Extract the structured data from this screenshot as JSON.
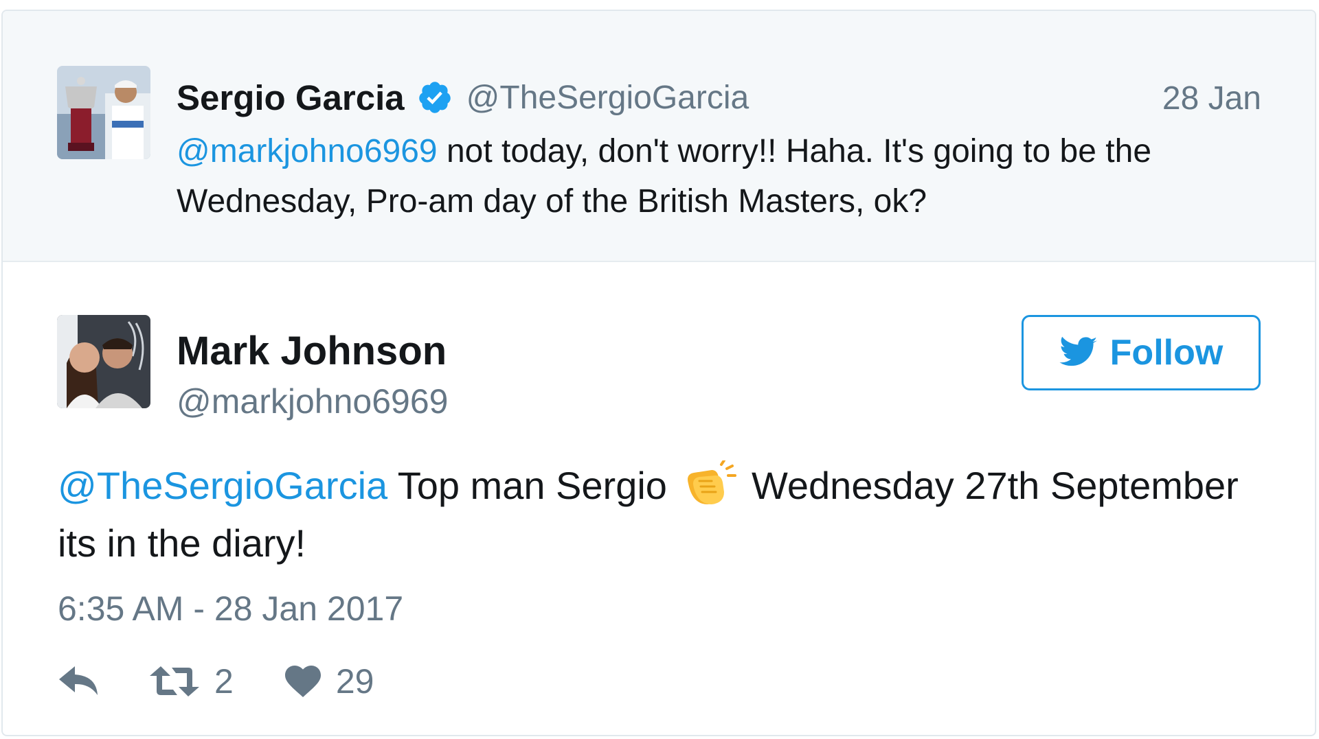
{
  "parent_tweet": {
    "author_name": "Sergio Garcia",
    "author_handle": "@TheSergioGarcia",
    "date": "28 Jan",
    "mention": "@markjohno6969",
    "text": " not today, don't worry!! Haha. It's going to be the Wednesday, Pro-am day of the British Masters, ok?",
    "verified_icon": "verified-badge-icon"
  },
  "reply_tweet": {
    "author_name": "Mark Johnson",
    "author_handle": "@markjohno6969",
    "follow_label": "Follow",
    "mention": "@TheSergioGarcia",
    "text_before_emoji": " Top man Sergio ",
    "emoji": "clapping-hands-emoji",
    "text_after_emoji": " Wednesday 27th September its in the diary!",
    "timestamp": "6:35 AM - 28 Jan 2017",
    "retweet_count": "2",
    "like_count": "29"
  },
  "icons": {
    "reply": "reply-icon",
    "retweet": "retweet-icon",
    "like": "heart-icon",
    "follow": "twitter-bird-icon"
  },
  "colors": {
    "link": "#1b95e0",
    "muted": "#657786",
    "text": "#14171a",
    "parent_bg": "#f5f8fa",
    "verified": "#1da1f2"
  }
}
